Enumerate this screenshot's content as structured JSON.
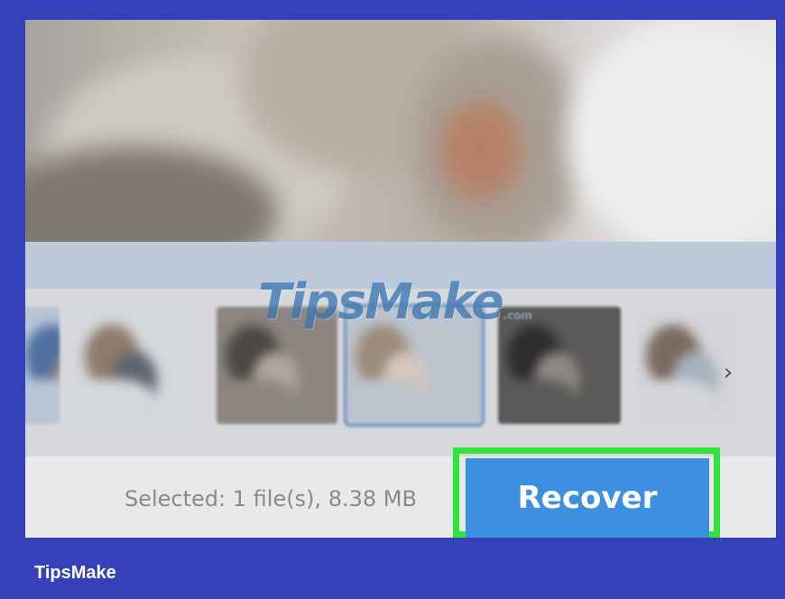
{
  "preview": {
    "icon": "blurred-photo-preview"
  },
  "thumbnails": [
    {
      "name": "thumbnail-1",
      "colors": [
        "#b8c5d6",
        "#4f6fa0",
        "#9b8f84"
      ]
    },
    {
      "name": "thumbnail-2",
      "colors": [
        "#d4d7dc",
        "#8f7b6a",
        "#5e6572"
      ]
    },
    {
      "name": "thumbnail-3",
      "colors": [
        "#8d8680",
        "#4d4844",
        "#b0a79e"
      ]
    },
    {
      "name": "thumbnail-4",
      "colors": [
        "#bcc3cc",
        "#9c8a7a",
        "#d4c7bb"
      ]
    },
    {
      "name": "thumbnail-5",
      "colors": [
        "#5c5a58",
        "#2f2d2c",
        "#8e8983"
      ]
    },
    {
      "name": "thumbnail-6",
      "colors": [
        "#d3d5d8",
        "#7a6b5f",
        "#a7b3c0"
      ]
    }
  ],
  "selected_thumbnail_index": 3,
  "next_icon": "chevron-right-icon",
  "next_glyph": "›",
  "status": {
    "selected_text": "Selected: 1 file(s), 8.38 MB"
  },
  "actions": {
    "recover_label": "Recover"
  },
  "watermark": {
    "text": "TipsMake",
    "suffix": ".com"
  },
  "caption": "TipsMake",
  "colors": {
    "frame": "#3441b8",
    "highlight": "#2fe43a",
    "recover_button": "#3d8fe0"
  }
}
